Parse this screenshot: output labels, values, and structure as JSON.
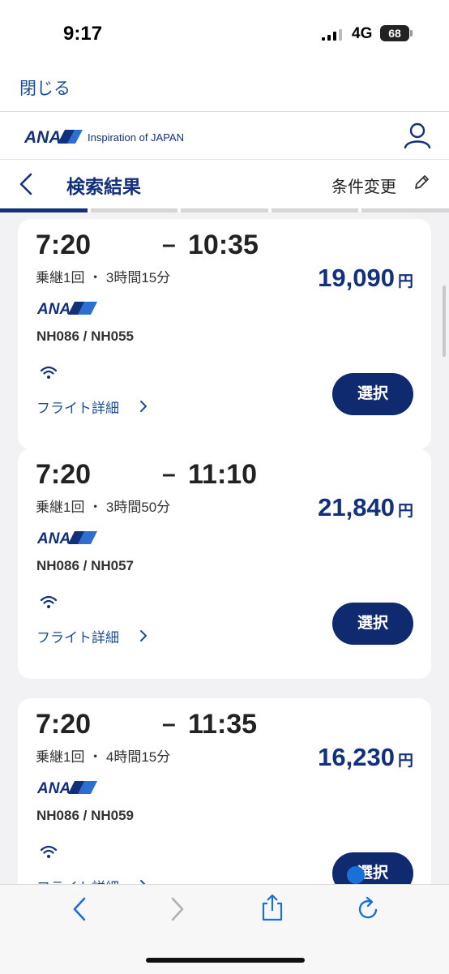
{
  "status_bar": {
    "time": "9:17",
    "network": "4G",
    "battery": "68"
  },
  "close_bar": {
    "close_label": "閉じる"
  },
  "brand": {
    "logo_text": "ANA",
    "tagline": "Inspiration of JAPAN"
  },
  "nav": {
    "title": "検索結果",
    "change_label": "条件変更",
    "progress_segments": 5,
    "active_segment": 1
  },
  "flights": [
    {
      "dep": "7:20",
      "arr": "10:35",
      "dash": "–",
      "meta": "乗継1回 ・ 3時間15分",
      "price": "19,090",
      "yen": "円",
      "flight_numbers": "NH086 / NH055",
      "detail_label": "フライト詳細",
      "select_label": "選択"
    },
    {
      "dep": "7:20",
      "arr": "11:10",
      "dash": "–",
      "meta": "乗継1回 ・ 3時間50分",
      "price": "21,840",
      "yen": "円",
      "flight_numbers": "NH086 / NH057",
      "detail_label": "フライト詳細",
      "select_label": "選択"
    },
    {
      "dep": "7:20",
      "arr": "11:35",
      "dash": "–",
      "meta": "乗継1回 ・ 4時間15分",
      "price": "16,230",
      "yen": "円",
      "flight_numbers": "NH086 / NH059",
      "detail_label": "フライト詳細",
      "select_label": "選択"
    }
  ],
  "toolbar": {
    "icons": [
      "back-icon",
      "forward-icon",
      "share-icon",
      "reload-icon"
    ]
  },
  "colors": {
    "ana_blue": "#13307a",
    "link_blue": "#1d4e99",
    "button_navy": "#0f2a6e",
    "accent_blue": "#1a6fd8"
  }
}
